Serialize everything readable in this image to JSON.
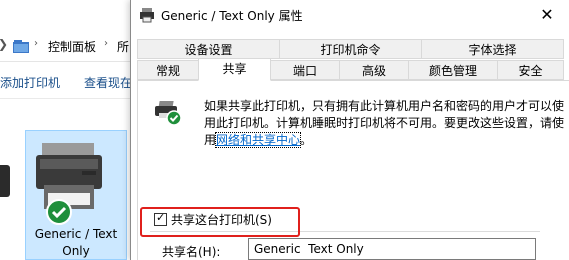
{
  "explorer": {
    "breadcrumb": [
      "控制面板",
      "所"
    ],
    "commands": [
      "添加打印机",
      "查看现在"
    ],
    "printer_name": "Generic / Text Only"
  },
  "dialog": {
    "title": "Generic / Text Only 属性",
    "close_glyph": "✕",
    "tabs_row1": [
      "设备设置",
      "打印机命令",
      "字体选择"
    ],
    "tabs_row2": [
      "常规",
      "共享",
      "端口",
      "高级",
      "颜色管理",
      "安全"
    ],
    "active_tab": "共享",
    "share": {
      "description_main": "如果共享此打印机，只有拥有此计算机用户名和密码的用户才可以使用此打印机。计算机睡眠时打印机将不可用。要更改这些设置，请使用",
      "link_text": "网络和共享中心",
      "link_tail": "。",
      "checkbox_label": "共享这台打印机(S)",
      "checkbox_checked": true,
      "sharename_label": "共享名(H):",
      "sharename_value": "Generic  Text Only"
    }
  },
  "colors": {
    "highlight": "#e0201c",
    "selection": "#cce8ff",
    "link": "#0066cc"
  }
}
